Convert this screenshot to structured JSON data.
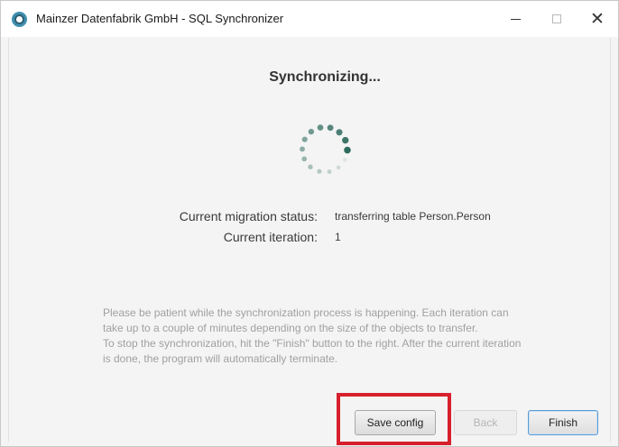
{
  "window": {
    "title": "Mainzer Datenfabrik GmbH - SQL Synchronizer",
    "controls": {
      "minimize": "minimize-icon",
      "maximize": "maximize-icon",
      "close": "close-icon"
    }
  },
  "main": {
    "heading": "Synchronizing...",
    "spinner_icon": "loading-spinner-icon",
    "status": {
      "migration_label": "Current migration status:",
      "migration_value": "transferring table Person.Person",
      "iteration_label": "Current iteration:",
      "iteration_value": "1"
    },
    "info_lines": [
      "Please be patient while the synchronization process is happening. Each iteration can",
      "take up to a couple of minutes depending on the size of the objects to transfer.",
      "To stop the synchronization, hit the \"Finish\" button to the right. After the current iteration",
      "is done, the program will automatically terminate."
    ]
  },
  "buttons": {
    "save_config": "Save config",
    "back": "Back",
    "finish": "Finish"
  },
  "colors": {
    "spinner": "#2e6b5e",
    "highlight": "#d8202d",
    "finish_border": "#5b9bd5"
  }
}
